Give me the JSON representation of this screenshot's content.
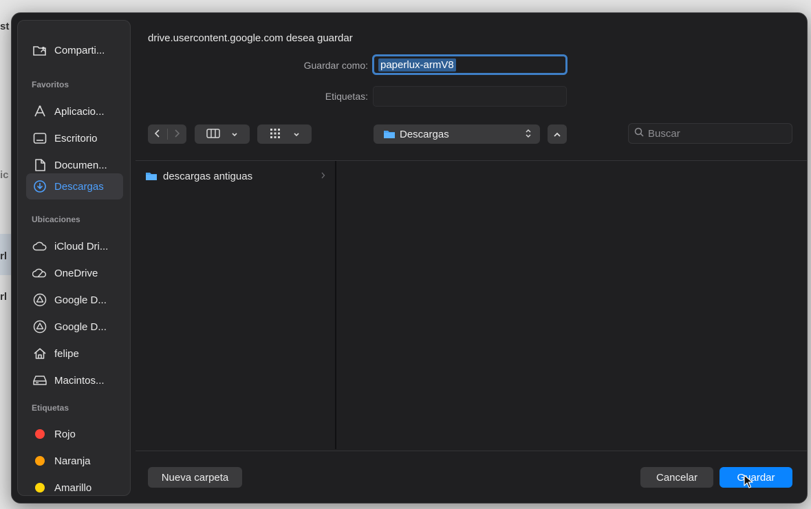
{
  "background": {
    "fragments": [
      "st",
      "ic",
      "rl",
      "rl"
    ]
  },
  "sidebar": {
    "shared_item": {
      "label": "Comparti...",
      "icon": "shared-folder-icon"
    },
    "sections": {
      "favorites": "Favoritos",
      "locations": "Ubicaciones",
      "tags": "Etiquetas"
    },
    "favorites": [
      {
        "label": "Aplicacio...",
        "icon": "applications-icon"
      },
      {
        "label": "Escritorio",
        "icon": "desktop-icon"
      },
      {
        "label": "Documen...",
        "icon": "document-icon"
      },
      {
        "label": "Descargas",
        "icon": "downloads-icon",
        "active": true
      }
    ],
    "locations": [
      {
        "label": "iCloud Dri...",
        "icon": "cloud-icon"
      },
      {
        "label": "OneDrive",
        "icon": "onedrive-icon"
      },
      {
        "label": "Google D...",
        "icon": "google-drive-icon"
      },
      {
        "label": "Google D...",
        "icon": "google-drive-icon"
      },
      {
        "label": "felipe",
        "icon": "home-icon"
      },
      {
        "label": "Macintos...",
        "icon": "hard-drive-icon"
      }
    ],
    "tags": [
      {
        "label": "Rojo",
        "color": "#ff453a"
      },
      {
        "label": "Naranja",
        "color": "#ff9f0a"
      },
      {
        "label": "Amarillo",
        "color": "#ffd60a"
      }
    ]
  },
  "dialog": {
    "title": "drive.usercontent.google.com desea guardar",
    "save_as_label": "Guardar como:",
    "save_as_value": "paperlux-armV8",
    "tags_label": "Etiquetas:",
    "tags_value": "",
    "location": "Descargas",
    "search_placeholder": "Buscar",
    "files": [
      {
        "name": "descargas antiguas",
        "icon": "folder-icon"
      }
    ],
    "new_folder_label": "Nueva carpeta",
    "cancel_label": "Cancelar",
    "save_label": "Guardar",
    "accent": "#0a84ff"
  }
}
